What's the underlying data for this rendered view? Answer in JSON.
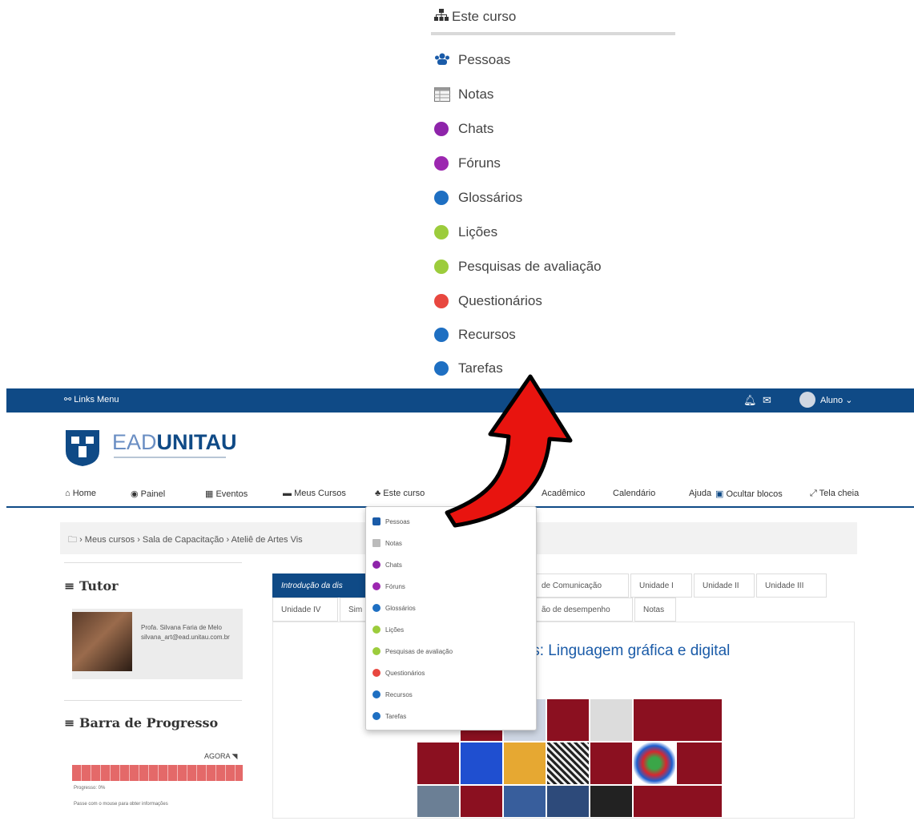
{
  "zoom_menu": {
    "header": "Este curso",
    "items": [
      {
        "label": "Pessoas",
        "icon": "people-icon"
      },
      {
        "label": "Notas",
        "icon": "grades-table-icon"
      },
      {
        "label": "Chats",
        "icon": "chat-icon",
        "color": "#8e24aa"
      },
      {
        "label": "Fóruns",
        "icon": "forum-icon",
        "color": "#9c27b0"
      },
      {
        "label": "Glossários",
        "icon": "glossary-icon",
        "color": "#1e6fc2"
      },
      {
        "label": "Lições",
        "icon": "lesson-icon",
        "color": "#9ccc3c"
      },
      {
        "label": "Pesquisas de avaliação",
        "icon": "survey-icon",
        "color": "#9ccc3c"
      },
      {
        "label": "Questionários",
        "icon": "quiz-icon",
        "color": "#e8473f"
      },
      {
        "label": "Recursos",
        "icon": "resource-icon",
        "color": "#1e6fc2"
      },
      {
        "label": "Tarefas",
        "icon": "assignment-icon",
        "color": "#1e6fc2"
      }
    ]
  },
  "topbar": {
    "links_menu": "Links Menu",
    "user": "Aluno",
    "color": "#0f4a86"
  },
  "logo": {
    "thin": "EAD",
    "bold": "UNITAU"
  },
  "nav": {
    "items": [
      "Home",
      "Painel",
      "Eventos",
      "Meus Cursos",
      "Este curso",
      "Acadêmico",
      "Calendário",
      "Ajuda",
      "Ocultar blocos",
      "Tela cheia"
    ]
  },
  "breadcrumb": "› Meus cursos › Sala de Capacitação › Ateliê de Artes Vis",
  "tutor": {
    "title": "Tutor",
    "name": "Profa. Silvana Faria de Melo",
    "email": "silvana_art@ead.unitau.com.br"
  },
  "progress": {
    "title": "Barra de Progresso",
    "now": "AGORA",
    "label": "Progresso: 0%",
    "hint": "Passe com o mouse para obter informações",
    "value_percent": 0
  },
  "tabs_row1": [
    "Introdução da dis",
    "de Comunicação",
    "Unidade I",
    "Unidade II",
    "Unidade III"
  ],
  "tabs_row2": [
    "Unidade IV",
    "Sim",
    "ão de desempenho",
    "Notas"
  ],
  "course_title": "is: Linguagem gráfica e digital",
  "dropdown": {
    "items": [
      "Pessoas",
      "Notas",
      "Chats",
      "Fóruns",
      "Glossários",
      "Lições",
      "Pesquisas de avaliação",
      "Questionários",
      "Recursos",
      "Tarefas"
    ]
  }
}
